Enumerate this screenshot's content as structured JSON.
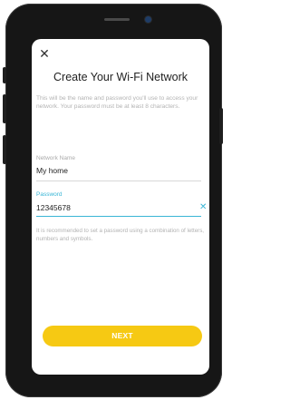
{
  "header": {
    "close_icon": "✕",
    "title": "Create Your Wi-Fi Network",
    "description": "This will be the name and password you'll use to access your network. Your password must be at least 8 characters."
  },
  "network_name": {
    "label": "Network Name",
    "value": "My home"
  },
  "password": {
    "label": "Password",
    "value": "12345678",
    "clear_icon": "✕"
  },
  "hint": "It is recommended to set a password using a combination of letters, numbers and symbols.",
  "actions": {
    "next_label": "NEXT"
  },
  "colors": {
    "accent": "#3ab6d6",
    "button": "#f6c913"
  }
}
